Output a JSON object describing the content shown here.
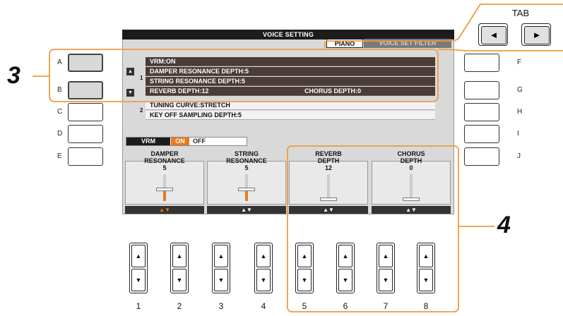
{
  "screen": {
    "title": "VOICE SETTING",
    "tabs": [
      {
        "label": "PIANO"
      },
      {
        "label": "VOICE SET FILTER"
      }
    ],
    "param_group_1": {
      "num": "1",
      "rows": [
        "VRM:ON",
        "DAMPER RESONANCE DEPTH:5",
        "STRING RESONANCE DEPTH:5",
        "REVERB DEPTH:12"
      ],
      "chorus": "CHORUS DEPTH:0"
    },
    "param_group_2": {
      "num": "2",
      "rows": [
        "TUNING CURVE:STRETCH",
        "KEY OFF SAMPLING DEPTH:5"
      ]
    },
    "vrm": {
      "label": "VRM",
      "on": "ON",
      "off": "OFF",
      "state": "on"
    },
    "knobs": [
      {
        "name_line1": "DAMPER",
        "name_line2": "RESONANCE",
        "value": "5",
        "level": 0.5,
        "active": true
      },
      {
        "name_line1": "STRING",
        "name_line2": "RESONANCE",
        "value": "5",
        "level": 0.5,
        "active": false
      },
      {
        "name_line1": "REVERB",
        "name_line2": "DEPTH",
        "value": "12",
        "level": 0.12,
        "active": false
      },
      {
        "name_line1": "CHORUS",
        "name_line2": "DEPTH",
        "value": "0",
        "level": 0.0,
        "active": false
      }
    ],
    "arrow_glyph": "▲▼"
  },
  "left_buttons": [
    {
      "letter": "A"
    },
    {
      "letter": "B"
    },
    {
      "letter": "C"
    },
    {
      "letter": "D"
    },
    {
      "letter": "E"
    }
  ],
  "right_buttons": [
    {
      "letter": "F"
    },
    {
      "letter": "G"
    },
    {
      "letter": "H"
    },
    {
      "letter": "I"
    },
    {
      "letter": "J"
    }
  ],
  "tab_control": {
    "label": "TAB",
    "left": "◄",
    "right": "►"
  },
  "steps": {
    "three": "3",
    "four": "4"
  },
  "bottom_buttons": [
    {
      "num": "1",
      "up": "▲",
      "down": "▼"
    },
    {
      "num": "2",
      "up": "▲",
      "down": "▼"
    },
    {
      "num": "3",
      "up": "▲",
      "down": "▼"
    },
    {
      "num": "4",
      "up": "▲",
      "down": "▼"
    },
    {
      "num": "5",
      "up": "▲",
      "down": "▼"
    },
    {
      "num": "6",
      "up": "▲",
      "down": "▼"
    },
    {
      "num": "7",
      "up": "▲",
      "down": "▼"
    },
    {
      "num": "8",
      "up": "▲",
      "down": "▼"
    }
  ],
  "colors": {
    "accent": "#e87b1e",
    "callout": "#f09a3e",
    "panel_dark": "#4a3c38"
  },
  "icons": {
    "scroll_up": "scroll-up-icon",
    "scroll_down": "scroll-down-icon"
  }
}
